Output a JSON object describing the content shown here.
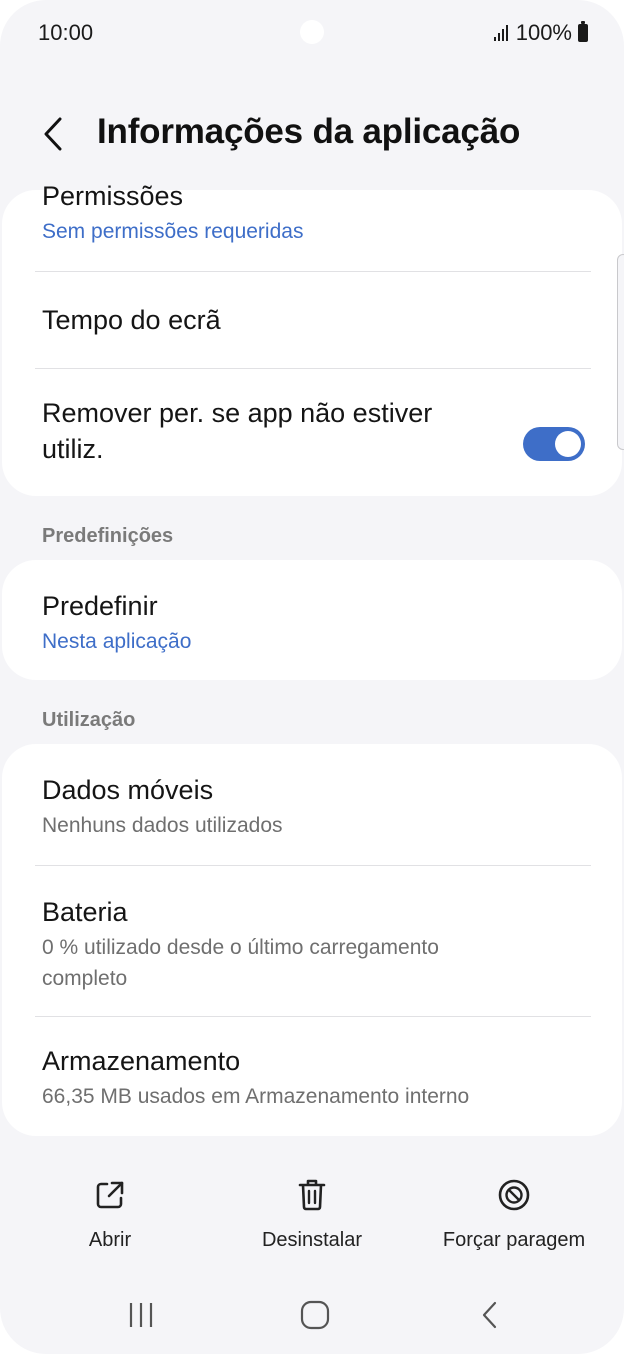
{
  "status_bar": {
    "time": "10:00",
    "battery_text": "100%"
  },
  "header": {
    "title": "Informações da aplicação"
  },
  "card1": {
    "permissions_title": "Permissões",
    "permissions_sub": "Sem permissões requeridas",
    "screen_time_title": "Tempo do ecrã",
    "remove_perm_line1": "Remover per. se app não estiver",
    "remove_perm_line2": "utiliz.",
    "remove_perm_enabled": true
  },
  "section_defaults": {
    "label": "Predefinições",
    "set_default_title": "Predefinir",
    "set_default_sub": "Nesta aplicação"
  },
  "section_usage": {
    "label": "Utilização",
    "mobile_data_title": "Dados móveis",
    "mobile_data_sub": "Nenhuns dados utilizados",
    "battery_title": "Bateria",
    "battery_sub_line1": "0 % utilizado desde o último carregamento",
    "battery_sub_line2": "completo",
    "storage_title": "Armazenamento",
    "storage_sub": "66,35 MB usados em Armazenamento interno"
  },
  "actions": {
    "open_label": "Abrir",
    "uninstall_label": "Desinstalar",
    "force_stop_label": "Forçar paragem"
  },
  "icons": [
    "back-icon",
    "open-external-icon",
    "trash-icon",
    "stop-icon",
    "recents-icon",
    "home-icon",
    "nav-back-icon"
  ],
  "colors": {
    "accent": "#3e6ec8",
    "background": "#f5f5f8",
    "card": "#ffffff"
  }
}
